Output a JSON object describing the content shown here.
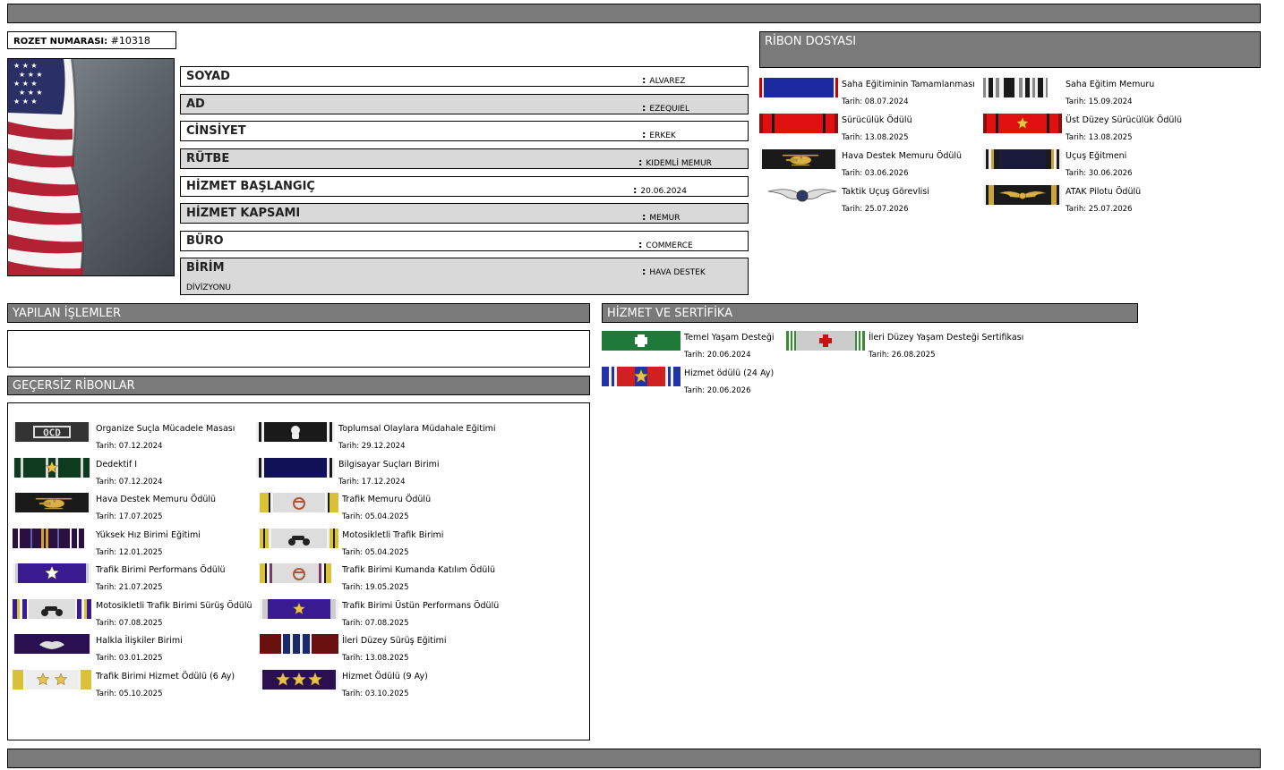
{
  "badge": {
    "label": "ROZET NUMARASI:",
    "number": "#10318"
  },
  "fields": [
    {
      "label": "SOYAD",
      "value": "ALVAREZ"
    },
    {
      "label": "AD",
      "value": "EZEQUIEL"
    },
    {
      "label": "CİNSİYET",
      "value": "ERKEK"
    },
    {
      "label": "RÜTBE",
      "value": "KIDEMLİ MEMUR"
    },
    {
      "label": "HİZMET BAŞLANGIÇ",
      "value": "20.06.2024"
    },
    {
      "label": "HİZMET KAPSAMI",
      "value": "MEMUR"
    },
    {
      "label": "BÜRO",
      "value": "COMMERCE"
    },
    {
      "label": "BİRİM",
      "value": "HAVA DESTEK",
      "value2": "DİVİZYONU"
    }
  ],
  "sections": {
    "ribbons": "RİBON DOSYASI",
    "actions": "YAPILAN İŞLEMLER",
    "invalid": "GEÇERSİZ RİBONLAR",
    "service": "HİZMET VE SERTİFİKA"
  },
  "ribbon_file": [
    {
      "name": "Saha Eğitiminin Tamamlanması",
      "date": "Tarih: 08.07.2024",
      "icon": "ribbon-field-training"
    },
    {
      "name": "Saha Eğitim Memuru",
      "date": "Tarih: 15.09.2024",
      "icon": "ribbon-fto"
    },
    {
      "name": "Sürücülük Ödülü",
      "date": "Tarih: 13.08.2025",
      "icon": "ribbon-driving"
    },
    {
      "name": "Üst Düzey Sürücülük Ödülü",
      "date": "Tarih: 13.08.2025",
      "icon": "ribbon-driving-star"
    },
    {
      "name": "Hava Destek Memuru Ödülü",
      "date": "Tarih: 03.06.2026",
      "icon": "ribbon-helicopter"
    },
    {
      "name": "Uçuş Eğitmeni",
      "date": "Tarih: 30.06.2026",
      "icon": "ribbon-flight-instructor"
    },
    {
      "name": "Taktik Uçuş Görevlisi",
      "date": "Tarih: 25.07.2026",
      "icon": "wings-badge"
    },
    {
      "name": "ATAK Pilotu Ödülü",
      "date": "Tarih: 25.07.2026",
      "icon": "ribbon-pilot-wings"
    }
  ],
  "service_certs": [
    {
      "name": "Temel Yaşam Desteği",
      "date": "Tarih: 20.06.2024",
      "icon": "ribbon-bls"
    },
    {
      "name": "İleri Düzey Yaşam Desteği Sertifikası",
      "date": "Tarih: 26.08.2025",
      "icon": "ribbon-als"
    },
    {
      "name": "Hizmet ödülü (24 Ay)",
      "date": "Tarih: 20.06.2026",
      "icon": "ribbon-service-24"
    }
  ],
  "invalid_ribbons": [
    {
      "name": "Organize Suçla Mücadele Masası",
      "date": "Tarih: 07.12.2024",
      "icon": "ribbon-ocd"
    },
    {
      "name": "Toplumsal Olaylara Müdahale Eğitimi",
      "date": "Tarih: 29.12.2024",
      "icon": "ribbon-gas-mask"
    },
    {
      "name": "Dedektif I",
      "date": "Tarih: 07.12.2024",
      "icon": "ribbon-detective"
    },
    {
      "name": "Bilgisayar Suçları Birimi",
      "date": "Tarih: 17.12.2024",
      "icon": "ribbon-cyber"
    },
    {
      "name": "Hava Destek Memuru Ödülü",
      "date": "Tarih: 17.07.2025",
      "icon": "ribbon-helicopter"
    },
    {
      "name": "Trafik Memuru Ödülü",
      "date": "Tarih: 05.04.2025",
      "icon": "ribbon-traffic"
    },
    {
      "name": "Yüksek Hız Birimi Eğitimi",
      "date": "Tarih: 12.01.2025",
      "icon": "ribbon-high-speed"
    },
    {
      "name": "Motosikletli Trafik Birimi",
      "date": "Tarih: 05.04.2025",
      "icon": "ribbon-motorcycle"
    },
    {
      "name": "Trafik Birimi Performans Ödülü",
      "date": "Tarih: 21.07.2025",
      "icon": "ribbon-purple-star"
    },
    {
      "name": "Trafik Birimi Kumanda Katılım Ödülü",
      "date": "Tarih: 19.05.2025",
      "icon": "ribbon-traffic-command"
    },
    {
      "name": "Motosikletli Trafik Birimi Sürüş Ödülü",
      "date": "Tarih: 07.08.2025",
      "icon": "ribbon-motorcycle-driving"
    },
    {
      "name": "Trafik Birimi Üstün Performans Ödülü",
      "date": "Tarih: 07.08.2025",
      "icon": "ribbon-purple-star-2"
    },
    {
      "name": "Halkla İlişkiler Birimi",
      "date": "Tarih: 03.01.2025",
      "icon": "ribbon-handshake"
    },
    {
      "name": "İleri Düzey Sürüş Eğitimi",
      "date": "Tarih: 13.08.2025",
      "icon": "ribbon-advanced-driving"
    },
    {
      "name": "Trafik Birimi Hizmet Ödülü (6 Ay)",
      "date": "Tarih: 05.10.2025",
      "icon": "ribbon-two-stars"
    },
    {
      "name": "Hizmet Ödülü (9 Ay)",
      "date": "Tarih: 03.10.2025",
      "icon": "ribbon-three-stars"
    }
  ],
  "colors": {
    "header_bar": "#7a7a7a",
    "field_alt": "#d9d9d9"
  }
}
